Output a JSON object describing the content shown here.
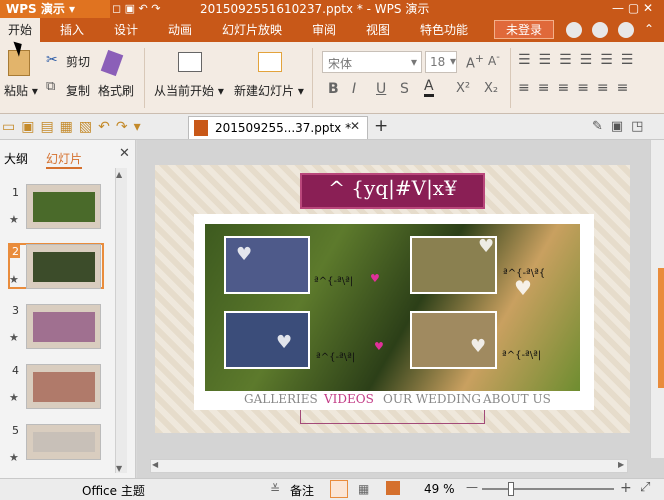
{
  "app": {
    "name": "WPS 演示",
    "title": "201509255161023​7.pptx * - WPS 演示"
  },
  "tabs": [
    "开始",
    "插入",
    "设计",
    "动画",
    "幻灯片放映",
    "审阅",
    "视图",
    "特色功能"
  ],
  "login_label": "未登录",
  "ribbon": {
    "paste": "粘贴",
    "cut": "剪切",
    "copy": "复制",
    "format_painter": "格式刷",
    "from_current": "从当前开始",
    "new_slide": "新建幻灯片",
    "font_name": "宋体",
    "font_size": "18",
    "bold": "B",
    "italic": "I",
    "underline": "U",
    "strike": "S",
    "font_color": "A",
    "superscript": "X²",
    "subscript": "X₂"
  },
  "doc_tab": "201509255...37.pptx *",
  "left_pane": {
    "outline_tab": "大纲",
    "slides_tab": "幻灯片",
    "slide_numbers": [
      "1",
      "2",
      "3",
      "4",
      "5"
    ]
  },
  "slide": {
    "header": "^ {yq|#V|x¥",
    "captions": [
      "ª^{-ª\\ª|",
      "ª^{-ª\\ª{",
      "ª^{-ª\\ª|",
      "ª^{-ª\\ª|"
    ],
    "nav": [
      "GALLERIES",
      "VIDEOS",
      "OUR WEDDING",
      "ABOUT US"
    ]
  },
  "status": {
    "theme": "Office 主题",
    "notes": "备注",
    "zoom": "49 %"
  }
}
